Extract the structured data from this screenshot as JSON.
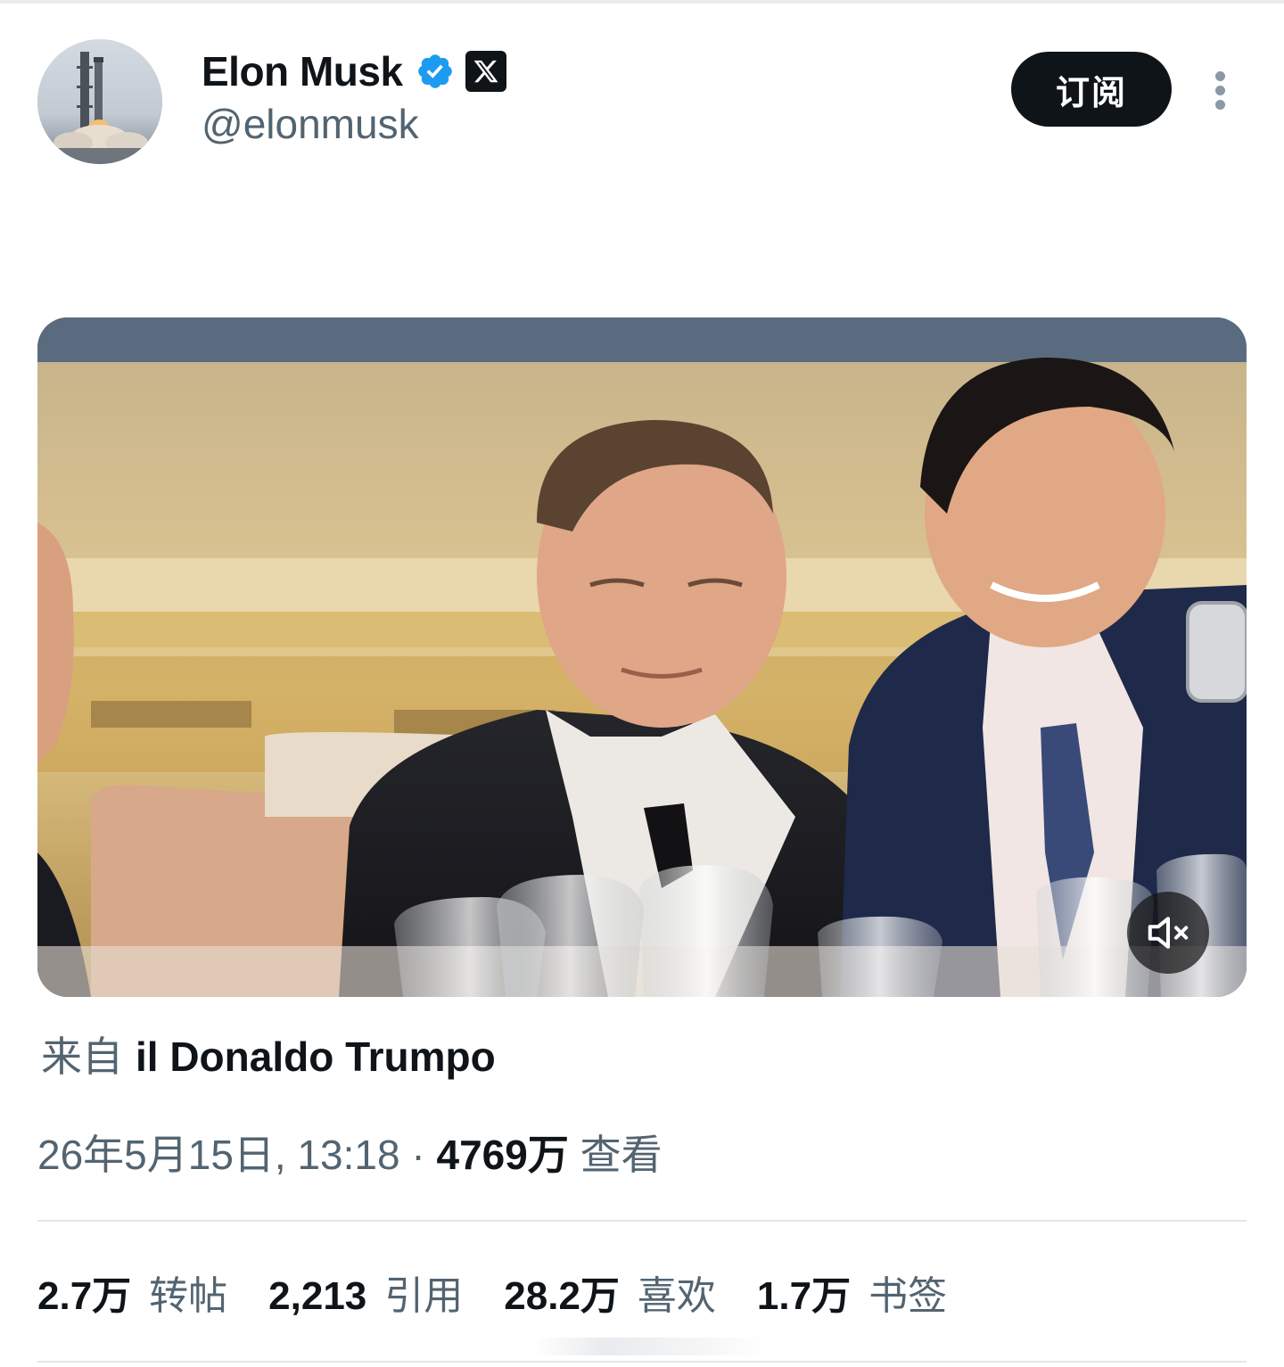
{
  "author": {
    "display_name": "Elon Musk",
    "handle": "@elonmusk",
    "avatar_icon": "rocket-launch-avatar",
    "verified_icon": "verified-badge-icon",
    "affiliation_icon": "x-logo-icon"
  },
  "header": {
    "subscribe_label": "订阅",
    "more_icon": "more-vertical-icon"
  },
  "media": {
    "type": "video",
    "mute_icon": "volume-muted-icon"
  },
  "source": {
    "prefix": "来自",
    "name": "il Donaldo Trumpo"
  },
  "meta": {
    "timestamp": "26年5月15日, 13:18",
    "separator": "·",
    "views_count": "4769万",
    "views_label": "查看"
  },
  "stats": [
    {
      "count": "2.7万",
      "label": "转帖"
    },
    {
      "count": "2,213",
      "label": "引用"
    },
    {
      "count": "28.2万",
      "label": "喜欢"
    },
    {
      "count": "1.7万",
      "label": "书签"
    }
  ],
  "colors": {
    "text_primary": "#0f1419",
    "text_secondary": "#536471",
    "verified_blue": "#1d9bf0",
    "button_dark": "#0f1419",
    "divider": "#e1e6ea"
  }
}
